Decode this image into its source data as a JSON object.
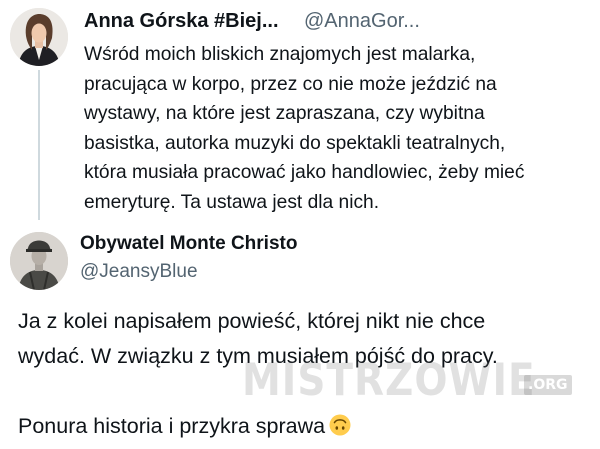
{
  "reply": {
    "author_name": "Anna Górska #Biej...",
    "author_handle": "@AnnaGor...",
    "text_lines": [
      "Wśród moich bliskich znajomych jest malarka,",
      "pracująca w korpo, przez co nie może jeździć na",
      "wystawy, na które jest zapraszana, czy wybitna",
      "basistka, autorka muzyki do spektakli teatralnych,",
      "która musiała pracować jako handlowiec, żeby mieć",
      "emeryturę. Ta ustawa jest dla nich."
    ]
  },
  "main": {
    "author_name": "Obywatel Monte Christo",
    "author_handle": "@JeansyBlue",
    "text_lines": [
      "Ja z kolei napisałem powieść, której nikt nie chce",
      "wydać. W związku z tym musiałem pójść do pracy.",
      "Ponura historia i przykra sprawa"
    ],
    "emoji": "upside-down-face"
  },
  "watermark": {
    "text": "MISTRZOWIE",
    "suffix": ".ORG"
  },
  "colors": {
    "text": "#0f1419",
    "secondary": "#536471",
    "thread_line": "#cfd9de",
    "emoji_yellow": "#ffcc4d"
  }
}
